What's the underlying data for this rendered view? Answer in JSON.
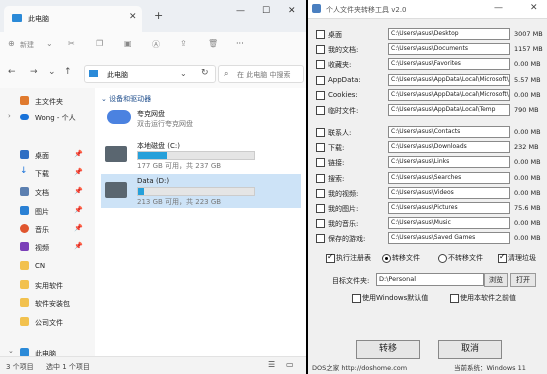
{
  "explorer": {
    "tab_title": "此电脑",
    "toolbar": {
      "new_label": "新建"
    },
    "nav": {
      "back": "←",
      "forward": "→",
      "up": "↑"
    },
    "address": "此电脑",
    "search_placeholder": "在 此电脑 中搜索",
    "sidebar": {
      "items": [
        {
          "label": "主文件夹"
        },
        {
          "label": "Wong - 个人"
        },
        {
          "label": "桌面"
        },
        {
          "label": "下载"
        },
        {
          "label": "文档"
        },
        {
          "label": "图片"
        },
        {
          "label": "音乐"
        },
        {
          "label": "视频"
        },
        {
          "label": "CN"
        },
        {
          "label": "实用软件"
        },
        {
          "label": "软件安装包"
        },
        {
          "label": "公司文件"
        },
        {
          "label": "此电脑"
        }
      ]
    },
    "content": {
      "section_title": "设备和驱动器",
      "cloud": {
        "name": "夸克网盘",
        "desc": "双击运行夸克网盘"
      },
      "drives": [
        {
          "name": "本地磁盘 (C:)",
          "stats": "177 GB 可用，共 237 GB",
          "used_fraction": 0.25
        },
        {
          "name": "Data (D:)",
          "stats": "213 GB 可用，共 223 GB",
          "used_fraction": 0.05
        }
      ]
    },
    "status": {
      "count": "3 个项目",
      "selected": "选中 1 个项目"
    }
  },
  "tool": {
    "title": "个人文件夹转移工具 v2.0",
    "folders_group1": [
      {
        "label": "桌面",
        "path": "C:\\Users\\asus\\Desktop",
        "size": "3007 MB",
        "checked": false
      },
      {
        "label": "我的文档:",
        "path": "C:\\Users\\asus\\Documents",
        "size": "1157 MB",
        "checked": false
      },
      {
        "label": "收藏夹:",
        "path": "C:\\Users\\asus\\Favorites",
        "size": "0.00 MB",
        "checked": false
      },
      {
        "label": "AppData:",
        "path": "C:\\Users\\asus\\AppData\\Local\\Microsoft\\Wi",
        "size": "5.57 MB",
        "checked": false
      },
      {
        "label": "Cookies:",
        "path": "C:\\Users\\asus\\AppData\\Local\\Microsoft\\Wi",
        "size": "0.00 MB",
        "checked": false
      },
      {
        "label": "临时文件:",
        "path": "C:\\Users\\asus\\AppData\\Local\\Temp",
        "size": "790 MB",
        "checked": false
      }
    ],
    "folders_group2": [
      {
        "label": "联系人:",
        "path": "C:\\Users\\asus\\Contacts",
        "size": "0.00 MB",
        "checked": false
      },
      {
        "label": "下载:",
        "path": "C:\\Users\\asus\\Downloads",
        "size": "232 MB",
        "checked": false
      },
      {
        "label": "链接:",
        "path": "C:\\Users\\asus\\Links",
        "size": "0.00 MB",
        "checked": false
      },
      {
        "label": "搜索:",
        "path": "C:\\Users\\asus\\Searches",
        "size": "0.00 MB",
        "checked": false
      },
      {
        "label": "我的视频:",
        "path": "C:\\Users\\asus\\Videos",
        "size": "0.00 MB",
        "checked": false
      },
      {
        "label": "我的图片:",
        "path": "C:\\Users\\asus\\Pictures",
        "size": "75.6 MB",
        "checked": false
      },
      {
        "label": "我的音乐:",
        "path": "C:\\Users\\asus\\Music",
        "size": "0.00 MB",
        "checked": false
      },
      {
        "label": "保存的游戏:",
        "path": "C:\\Users\\asus\\Saved Games",
        "size": "0.00 MB",
        "checked": false
      }
    ],
    "options": {
      "exec_registry": "执行注册表",
      "transfer_files": "转移文件",
      "no_transfer_files": "不转移文件",
      "clean_junk": "清理垃圾"
    },
    "target_label": "目标文件夹:",
    "target_value": "D:\\Personal",
    "browse_label": "浏览",
    "open_label": "打开",
    "use_default_label": "使用Windows默认值",
    "use_previous_label": "使用本软件之前值",
    "transfer_button": "转移",
    "cancel_button": "取消",
    "footer_left": "DOS之家 http://doshome.com",
    "footer_right": "当前系统：Windows 11"
  }
}
